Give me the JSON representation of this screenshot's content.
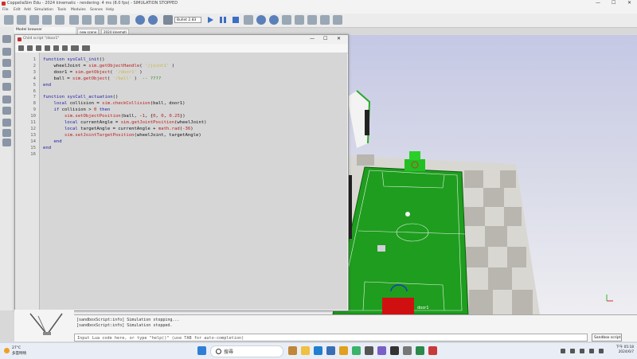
{
  "window": {
    "title": "CoppeliaSim Edu - 2024 kinematic - rendering: 4 ms (8.0 fps) - SIMULATION STOPPED",
    "min": "—",
    "max": "☐",
    "close": "✕"
  },
  "menu": [
    "File",
    "Edit",
    "Add",
    "Simulation",
    "Tools",
    "Modules",
    "Scenes",
    "Help"
  ],
  "toolbar": {
    "engine": "Bullet 2.83"
  },
  "model_browser": {
    "label": "Model browser"
  },
  "scene_tabs": [
    "new scene",
    "2024 kinemati"
  ],
  "editor": {
    "title": "Child script \"/door1\"",
    "lines": [
      {
        "n": "1",
        "c": [
          {
            "t": "function ",
            "k": "kw"
          },
          {
            "t": "sysCall_init",
            "k": "fn"
          },
          {
            "t": "()",
            "k": ""
          }
        ]
      },
      {
        "n": "2",
        "c": [
          {
            "t": "    wheelJoint = ",
            "k": ""
          },
          {
            "t": "sim.getObjectHandle",
            "k": "api"
          },
          {
            "t": "( ",
            "k": ""
          },
          {
            "t": "'/joint1'",
            "k": "str"
          },
          {
            "t": " )",
            "k": ""
          }
        ]
      },
      {
        "n": "3",
        "c": [
          {
            "t": "    door1 = ",
            "k": ""
          },
          {
            "t": "sim.getObject",
            "k": "api"
          },
          {
            "t": "( ",
            "k": ""
          },
          {
            "t": "'/door1'",
            "k": "str"
          },
          {
            "t": " )",
            "k": ""
          }
        ]
      },
      {
        "n": "4",
        "c": [
          {
            "t": "    ball = ",
            "k": ""
          },
          {
            "t": "sim.getObject",
            "k": "api"
          },
          {
            "t": "( ",
            "k": ""
          },
          {
            "t": "'/ball'",
            "k": "str"
          },
          {
            "t": " )",
            "k": ""
          },
          {
            "t": "  -- ????",
            "k": "cm"
          }
        ]
      },
      {
        "n": "5",
        "c": [
          {
            "t": "end",
            "k": "kw"
          }
        ]
      },
      {
        "n": "6",
        "c": [
          {
            "t": "",
            "k": ""
          }
        ]
      },
      {
        "n": "7",
        "c": [
          {
            "t": "function ",
            "k": "kw"
          },
          {
            "t": "sysCall_actuation",
            "k": "fn"
          },
          {
            "t": "()",
            "k": ""
          }
        ]
      },
      {
        "n": "8",
        "c": [
          {
            "t": "    local ",
            "k": "kw"
          },
          {
            "t": "collision = ",
            "k": ""
          },
          {
            "t": "sim.checkCollision",
            "k": "api"
          },
          {
            "t": "(ball, door1)",
            "k": ""
          }
        ]
      },
      {
        "n": "9",
        "c": [
          {
            "t": "    if ",
            "k": "kw"
          },
          {
            "t": "collision > ",
            "k": ""
          },
          {
            "t": "0",
            "k": "num"
          },
          {
            "t": " then",
            "k": "kw"
          }
        ]
      },
      {
        "n": "10",
        "c": [
          {
            "t": "        ",
            "k": ""
          },
          {
            "t": "sim.setObjectPosition",
            "k": "api"
          },
          {
            "t": "(ball, -",
            "k": ""
          },
          {
            "t": "1",
            "k": "num"
          },
          {
            "t": ", {",
            "k": ""
          },
          {
            "t": "0",
            "k": "num"
          },
          {
            "t": ", ",
            "k": ""
          },
          {
            "t": "0",
            "k": "num"
          },
          {
            "t": ", ",
            "k": ""
          },
          {
            "t": "0.25",
            "k": "num"
          },
          {
            "t": "})",
            "k": ""
          }
        ]
      },
      {
        "n": "11",
        "c": [
          {
            "t": "        local ",
            "k": "kw"
          },
          {
            "t": "currentAngle = ",
            "k": ""
          },
          {
            "t": "sim.getJointPosition",
            "k": "api"
          },
          {
            "t": "(wheelJoint)",
            "k": ""
          }
        ]
      },
      {
        "n": "12",
        "c": [
          {
            "t": "        local ",
            "k": "kw"
          },
          {
            "t": "targetAngle = currentAngle + ",
            "k": ""
          },
          {
            "t": "math.rad",
            "k": "api"
          },
          {
            "t": "(",
            "k": ""
          },
          {
            "t": "-36",
            "k": "num"
          },
          {
            "t": ")",
            "k": ""
          }
        ]
      },
      {
        "n": "13",
        "c": [
          {
            "t": "        ",
            "k": ""
          },
          {
            "t": "sim.setJointTargetPosition",
            "k": "api"
          },
          {
            "t": "(wheelJoint, targetAngle)",
            "k": ""
          }
        ]
      },
      {
        "n": "14",
        "c": [
          {
            "t": "    end",
            "k": "kw"
          }
        ]
      },
      {
        "n": "15",
        "c": [
          {
            "t": "end",
            "k": "kw"
          }
        ]
      },
      {
        "n": "16",
        "c": [
          {
            "t": "",
            "k": ""
          }
        ]
      }
    ]
  },
  "console": {
    "lines": [
      "[sandboxScript:info] Simulation stopping...",
      "[sandboxScript:info] Simulation stopped."
    ],
    "input_placeholder": "Input Lua code here, or type \"help()\" (use TAB for auto-completion)",
    "sandbox_label": "Sandbox script"
  },
  "scene": {
    "door_label": "door1"
  },
  "taskbar": {
    "weather_temp": "27°C",
    "weather_text": "多雲時晴",
    "search_label": "搜尋",
    "time": "下午 05:18",
    "date": "2024/6/7"
  }
}
